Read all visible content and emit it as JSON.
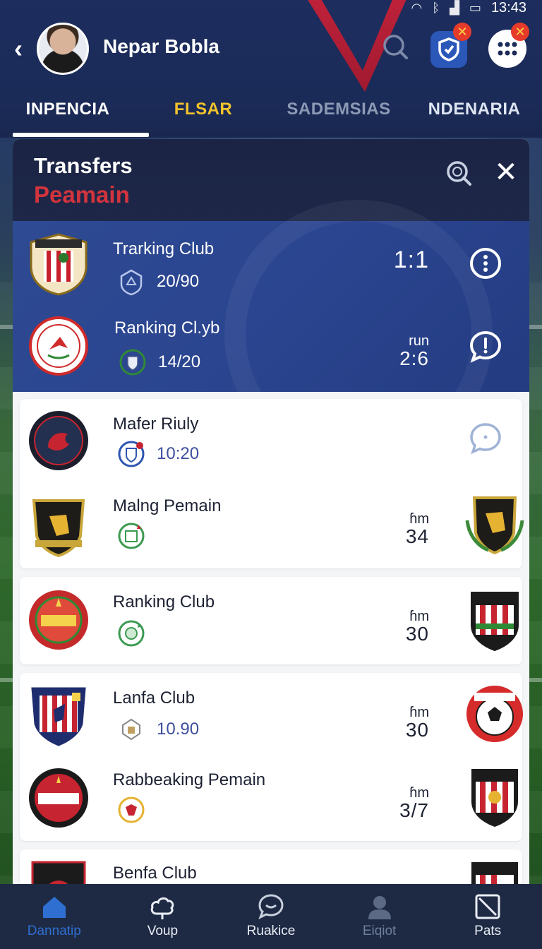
{
  "status_bar": {
    "time": "13:43"
  },
  "header": {
    "user_name": "Nepar Bobla"
  },
  "tabs": [
    {
      "label": "INPENCIA"
    },
    {
      "label": "FLSAR"
    },
    {
      "label": "SADEMSIAS"
    },
    {
      "label": "NDENARIA"
    }
  ],
  "panel": {
    "title": "Transfers",
    "subtitle": "Peamain"
  },
  "highlight_rows": [
    {
      "name": "Trarking Club",
      "sub": "20/90",
      "score_top": "",
      "score": "1:1",
      "action_icon": "more-icon"
    },
    {
      "name": "Ranking Cl.yb",
      "sub": "14/20",
      "score_top": "run",
      "score": "2:6",
      "action_icon": "chat-icon"
    }
  ],
  "rows": [
    {
      "name": "Mafer Riuly",
      "sub": "10:20",
      "score_top": "",
      "score": "",
      "action_icon": "chat-icon"
    },
    {
      "name": "Malng Pemain",
      "sub": "",
      "score_top": "ɦm",
      "score": "34",
      "action_icon": "club-crest"
    },
    {
      "name": "Ranking Club",
      "sub": "",
      "score_top": "ɦm",
      "score": "30",
      "action_icon": "club-crest"
    },
    {
      "name": "Lanfa Club",
      "sub": "10.90",
      "score_top": "ɦm",
      "score": "30",
      "action_icon": "club-crest"
    },
    {
      "name": "Rabbeaking Pemain",
      "sub": "",
      "score_top": "ɦm",
      "score": "3/7",
      "action_icon": "club-crest"
    },
    {
      "name": "Benfa Club",
      "sub": "",
      "score_top": "",
      "score": "",
      "action_icon": "club-crest"
    }
  ],
  "bottom_nav": [
    {
      "label": "Dannatip",
      "icon": "home-icon",
      "state": "active"
    },
    {
      "label": "Voup",
      "icon": "cloud-icon",
      "state": "normal"
    },
    {
      "label": "Ruakice",
      "icon": "chat-icon",
      "state": "normal"
    },
    {
      "label": "Eiqiot",
      "icon": "profile-icon",
      "state": "muted"
    },
    {
      "label": "Pats",
      "icon": "square-icon",
      "state": "normal"
    }
  ],
  "colors": {
    "header": "#1c2d5e",
    "accent_red": "#d2343d",
    "accent_yellow": "#f2c42c",
    "highlight": "#2e4a92",
    "nav_active": "#2f6fd1"
  }
}
